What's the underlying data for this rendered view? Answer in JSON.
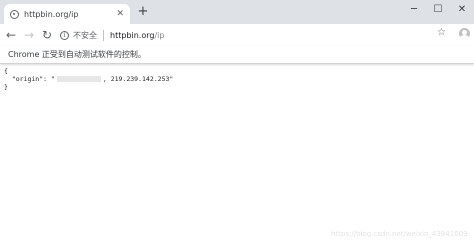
{
  "tab": {
    "title": "httpbin.org/ip",
    "close_glyph": "✕",
    "favicon": "globe-icon"
  },
  "new_tab_glyph": "+",
  "window_controls": {
    "minimize": "─",
    "maximize": "☐",
    "close": "✕"
  },
  "nav": {
    "back": "←",
    "forward": "→",
    "reload": "↻"
  },
  "omnibox": {
    "security_label": "不安全",
    "url_host": "httpbin.org",
    "url_path": "/ip"
  },
  "star_glyph": "☆",
  "infobar": {
    "message": "Chrome 正受到自动测试软件的控制。"
  },
  "body_lines": {
    "open": "{",
    "key": "  \"origin\": \"",
    "ip_suffix": ", 219.239.142.253\"",
    "close": "}"
  },
  "watermark": "https://blog.csdn.net/weixin_43941609"
}
